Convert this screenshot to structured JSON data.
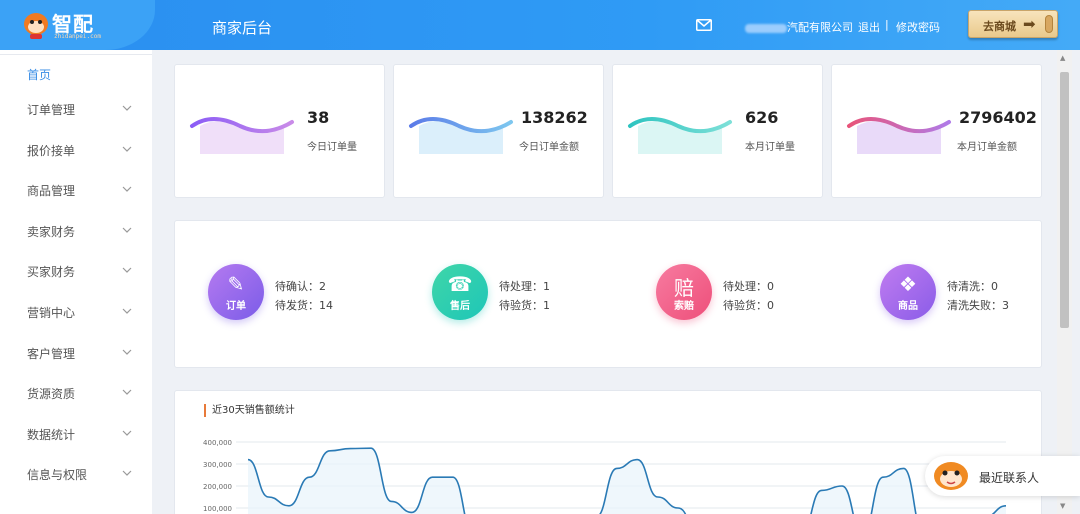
{
  "header": {
    "logo_text": "智配",
    "logo_sub": "zhidanpei.com",
    "title": "商家后台",
    "company": "汽配有限公司",
    "logout": "退出",
    "separator": "|",
    "change_password": "修改密码",
    "go_shop": "去商城"
  },
  "sidebar": {
    "home": "首页",
    "items": [
      {
        "label": "订单管理"
      },
      {
        "label": "报价接单"
      },
      {
        "label": "商品管理"
      },
      {
        "label": "卖家财务"
      },
      {
        "label": "买家财务"
      },
      {
        "label": "营销中心"
      },
      {
        "label": "客户管理"
      },
      {
        "label": "货源资质"
      },
      {
        "label": "数据统计"
      },
      {
        "label": "信息与权限"
      }
    ]
  },
  "stats": [
    {
      "value": "38",
      "label": "今日订单量",
      "color_a": "#8b5cf6",
      "color_b": "#c98be8"
    },
    {
      "value": "138262",
      "label": "今日订单金额",
      "color_a": "#5b7be8",
      "color_b": "#7ec7ef"
    },
    {
      "value": "626",
      "label": "本月订单量",
      "color_a": "#2ec4c0",
      "color_b": "#7ee0d8"
    },
    {
      "value": "2796402",
      "label": "本月订单金额",
      "color_a": "#e8547a",
      "color_b": "#b07be8"
    }
  ],
  "pending": [
    {
      "badge": "订单",
      "glyph": "✎",
      "color_a": "#7b5ce8",
      "color_b": "#b57af0",
      "line1": "待确认：2",
      "line2": "待发货：14"
    },
    {
      "badge": "售后",
      "glyph": "☎",
      "color_a": "#1ec6b8",
      "color_b": "#3fd6a8",
      "line1": "待处理：1",
      "line2": "待验货：1"
    },
    {
      "badge": "索赔",
      "glyph": "赔",
      "color_a": "#ee4f7a",
      "color_b": "#f77ba0",
      "line1": "待处理：0",
      "line2": "待验货：0"
    },
    {
      "badge": "商品",
      "glyph": "❖",
      "color_a": "#8a5ce8",
      "color_b": "#c07cf0",
      "line1": "待清洗：0",
      "line2": "清洗失败：3"
    }
  ],
  "chart_title": "近30天销售额统计",
  "chart_data": {
    "type": "line",
    "title": "近30天销售额统计",
    "yticks": [
      "400,000",
      "300,000",
      "200,000",
      "100,000"
    ],
    "ylim": [
      0,
      400000
    ],
    "series": [
      {
        "color": "#2a7ab5",
        "values": [
          320000,
          150000,
          110000,
          240000,
          360000,
          370000,
          372000,
          130000,
          80000,
          240000,
          240000,
          -20000,
          -20000,
          -20000,
          -20000,
          -20000,
          -20000,
          60000,
          280000,
          320000,
          150000,
          100000,
          -20000,
          -20000,
          -20000,
          -20000,
          -20000,
          -20000,
          180000,
          200000,
          -20000,
          240000,
          280000,
          -20000,
          -20000,
          -20000,
          60000,
          110000
        ]
      }
    ]
  },
  "contact_label": "最近联系人"
}
